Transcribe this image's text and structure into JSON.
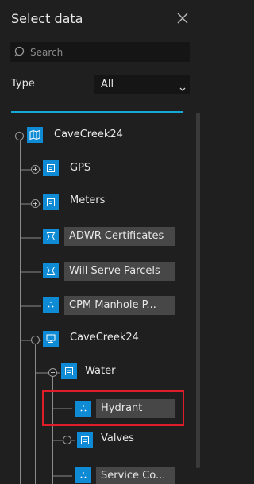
{
  "panel": {
    "title": "Select data"
  },
  "search": {
    "placeholder": "Search"
  },
  "filter": {
    "type_label": "Type",
    "type_value": "All"
  },
  "tree": {
    "root": {
      "label": "CaveCreek24",
      "icon": "map-icon"
    },
    "items": [
      {
        "label": "GPS",
        "icon": "table-icon"
      },
      {
        "label": "Meters",
        "icon": "table-icon"
      },
      {
        "label": "ADWR Certificates",
        "icon": "polygon-icon"
      },
      {
        "label": "Will Serve Parcels",
        "icon": "polygon-icon"
      },
      {
        "label": "CPM Manhole P...",
        "icon": "point-icon"
      },
      {
        "label": "CaveCreek24",
        "icon": "service-icon"
      },
      {
        "label": "Water",
        "icon": "table-icon"
      },
      {
        "label": "Hydrant",
        "icon": "point-icon",
        "selected": true
      },
      {
        "label": "Valves",
        "icon": "table-icon"
      },
      {
        "label": "Service Co...",
        "icon": "point-icon"
      }
    ]
  },
  "colors": {
    "accent": "#16a8d8",
    "node": "#0f8bd6",
    "highlight": "#e01c2a",
    "background": "#1f1f1f"
  }
}
